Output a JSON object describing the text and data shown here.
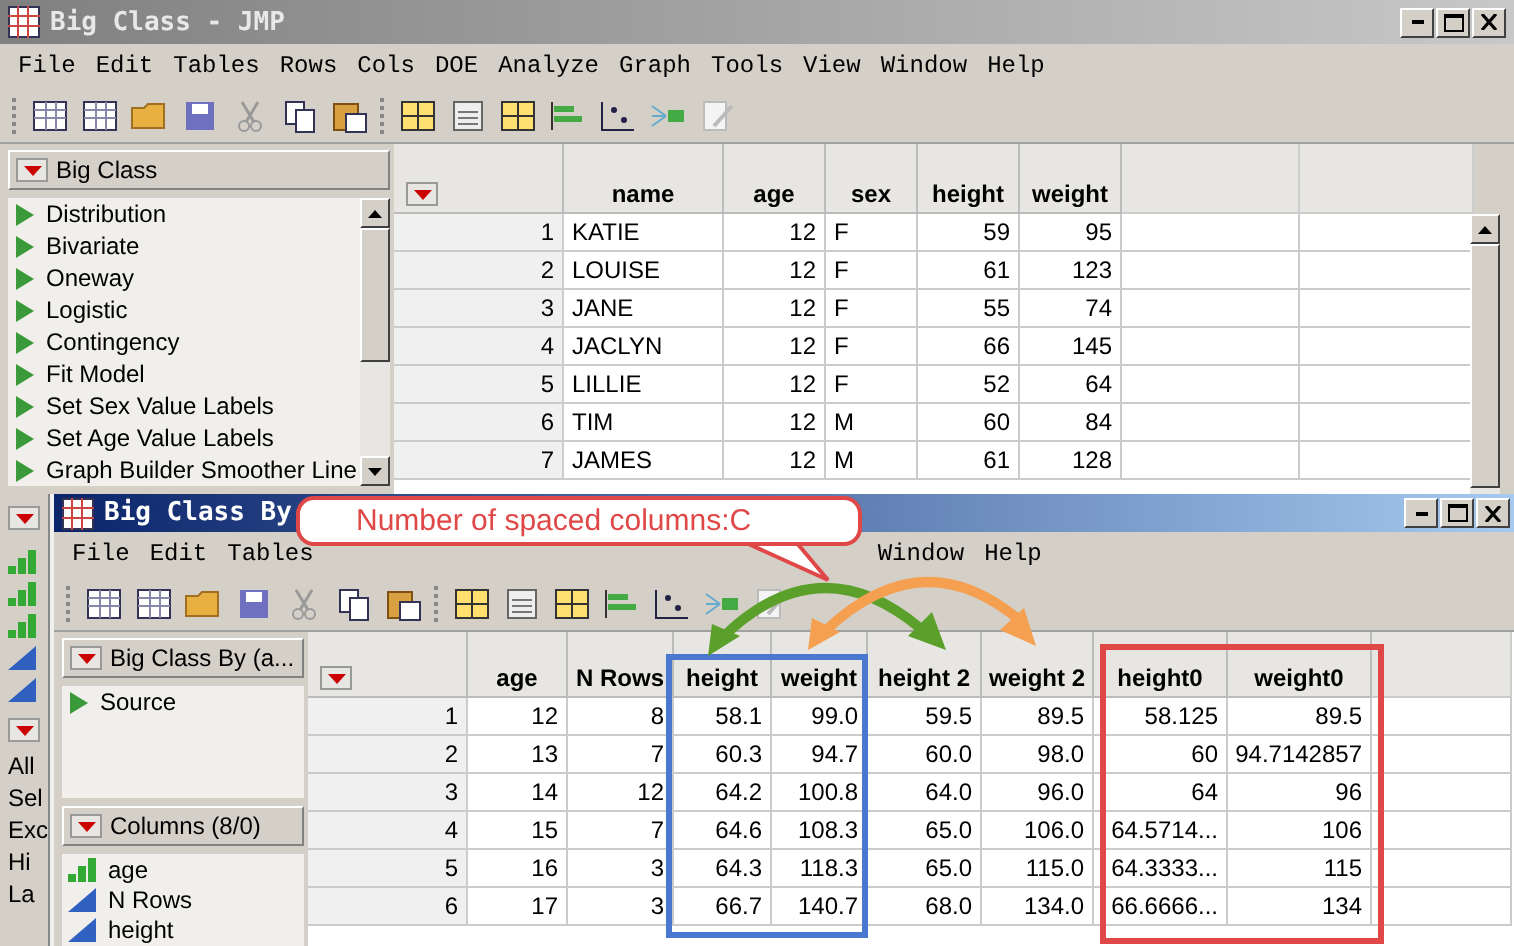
{
  "main_window": {
    "title": "Big Class - JMP",
    "menu": [
      "File",
      "Edit",
      "Tables",
      "Rows",
      "Cols",
      "DOE",
      "Analyze",
      "Graph",
      "Tools",
      "View",
      "Window",
      "Help"
    ],
    "table_panel": {
      "title": "Big Class",
      "scripts": [
        "Distribution",
        "Bivariate",
        "Oneway",
        "Logistic",
        "Contingency",
        "Fit Model",
        "Set Sex Value Labels",
        "Set Age Value Labels",
        "Graph Builder Smoother Line"
      ]
    },
    "side_strip": {
      "labels": [
        "All",
        "Sel",
        "Exc",
        "Hi",
        "La"
      ]
    },
    "table": {
      "columns": [
        {
          "name": "name",
          "kind": "character"
        },
        {
          "name": "age",
          "kind": "numeric"
        },
        {
          "name": "sex",
          "kind": "character"
        },
        {
          "name": "height",
          "kind": "numeric"
        },
        {
          "name": "weight",
          "kind": "numeric"
        }
      ],
      "rows": [
        {
          "number": "1",
          "cells": [
            "KATIE",
            "12",
            "F",
            "59",
            "95"
          ]
        },
        {
          "number": "2",
          "cells": [
            "LOUISE",
            "12",
            "F",
            "61",
            "123"
          ]
        },
        {
          "number": "3",
          "cells": [
            "JANE",
            "12",
            "F",
            "55",
            "74"
          ]
        },
        {
          "number": "4",
          "cells": [
            "JACLYN",
            "12",
            "F",
            "66",
            "145"
          ]
        },
        {
          "number": "5",
          "cells": [
            "LILLIE",
            "12",
            "F",
            "52",
            "64"
          ]
        },
        {
          "number": "6",
          "cells": [
            "TIM",
            "12",
            "M",
            "60",
            "84"
          ]
        },
        {
          "number": "7",
          "cells": [
            "JAMES",
            "12",
            "M",
            "61",
            "128"
          ]
        }
      ]
    }
  },
  "by_window": {
    "title": "Big Class By",
    "menu": [
      "File",
      "Edit",
      "Tables",
      "Window",
      "Help"
    ],
    "table_panel": {
      "title": "Big Class By (a...",
      "scripts": [
        "Source"
      ]
    },
    "columns_panel": {
      "title": "Columns (8/0)",
      "columns": [
        {
          "name": "age",
          "kind": "ordinal"
        },
        {
          "name": "N Rows",
          "kind": "continuous"
        },
        {
          "name": "height",
          "kind": "continuous"
        }
      ]
    },
    "table": {
      "columns": [
        {
          "name": "age",
          "kind": "numeric"
        },
        {
          "name": "N Rows",
          "kind": "numeric"
        },
        {
          "name": "height",
          "kind": "numeric"
        },
        {
          "name": "weight",
          "kind": "numeric"
        },
        {
          "name": "height 2",
          "kind": "numeric"
        },
        {
          "name": "weight 2",
          "kind": "numeric"
        },
        {
          "name": "height0",
          "kind": "numeric"
        },
        {
          "name": "weight0",
          "kind": "numeric"
        }
      ],
      "rows": [
        {
          "number": "1",
          "cells": [
            "12",
            "8",
            "58.1",
            "99.0",
            "59.5",
            "89.5",
            "58.125",
            "89.5"
          ]
        },
        {
          "number": "2",
          "cells": [
            "13",
            "7",
            "60.3",
            "94.7",
            "60.0",
            "98.0",
            "60",
            "94.7142857"
          ]
        },
        {
          "number": "3",
          "cells": [
            "14",
            "12",
            "64.2",
            "100.8",
            "64.0",
            "96.0",
            "64",
            "96"
          ]
        },
        {
          "number": "4",
          "cells": [
            "15",
            "7",
            "64.6",
            "108.3",
            "65.0",
            "106.0",
            "64.5714...",
            "106"
          ]
        },
        {
          "number": "5",
          "cells": [
            "16",
            "3",
            "64.3",
            "118.3",
            "65.0",
            "115.0",
            "64.3333...",
            "115"
          ]
        },
        {
          "number": "6",
          "cells": [
            "17",
            "3",
            "66.7",
            "140.7",
            "68.0",
            "134.0",
            "66.6666...",
            "134"
          ]
        }
      ]
    }
  },
  "callout": {
    "text": "Number of spaced columns:C"
  }
}
